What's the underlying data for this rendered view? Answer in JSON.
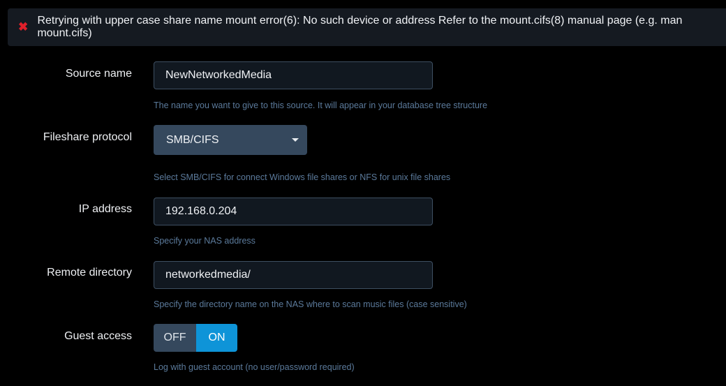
{
  "alert": {
    "icon": "close-icon",
    "glyph": "✖",
    "message": "Retrying with upper case share name mount error(6): No such device or address Refer to the mount.cifs(8) manual page (e.g. man mount.cifs)",
    "color": "#e0202a"
  },
  "fields": {
    "source_name": {
      "label": "Source name",
      "value": "NewNetworkedMedia",
      "help": "The name you want to give to this source. It will appear in your database tree structure"
    },
    "protocol": {
      "label": "Fileshare protocol",
      "value": "SMB/CIFS",
      "help": "Select SMB/CIFS for connect Windows file shares or NFS for unix file shares"
    },
    "ip": {
      "label": "IP address",
      "value": "192.168.0.204",
      "help": "Specify your NAS address"
    },
    "remote_dir": {
      "label": "Remote directory",
      "value": "networkedmedia/",
      "help": "Specify the directory name on the NAS where to scan music files (case sensitive)"
    },
    "guest": {
      "label": "Guest access",
      "off": "OFF",
      "on": "ON",
      "selected": "ON",
      "help": "Log with guest account (no user/password required)"
    }
  },
  "colors": {
    "accent": "#0e94d8",
    "control": "#35485d"
  }
}
